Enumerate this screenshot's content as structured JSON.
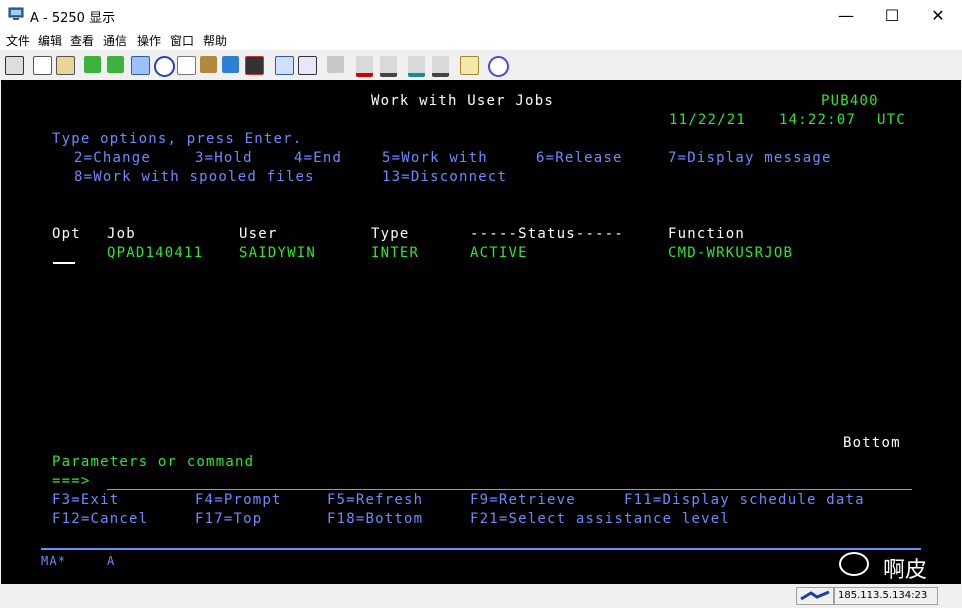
{
  "window": {
    "title": "A - 5250 显示",
    "minimize_glyph": "—",
    "maximize_glyph": "☐",
    "close_glyph": "✕"
  },
  "menu": [
    "文件",
    "编辑",
    "查看",
    "通信",
    "操作",
    "窗口",
    "帮助"
  ],
  "toolbar_icons": [
    "print-screen-icon",
    "copy-icon",
    "paste-icon",
    "send-file-icon",
    "receive-file-icon",
    "macro-icon",
    "navigator-icon",
    "notes-icon",
    "box-icon",
    "palette-icon",
    "film-icon",
    "keypad-icon",
    "grid-icon",
    "tools-icon",
    "record-macro-icon",
    "stop-macro-icon",
    "play-macro-icon",
    "pause-icon",
    "clipboard-icon",
    "help-icon"
  ],
  "screen": {
    "title": "Work with User Jobs",
    "system": "PUB400",
    "date": "11/22/21",
    "time": "14:22:07",
    "tz": "UTC",
    "instructions": "Type options, press Enter.",
    "options_line1": [
      "2=Change",
      "3=Hold",
      "4=End",
      "5=Work with",
      "6=Release",
      "7=Display message"
    ],
    "options_line2": [
      "8=Work with spooled files",
      "13=Disconnect"
    ],
    "columns": {
      "opt": "Opt",
      "job": "Job",
      "user": "User",
      "type": "Type",
      "status": "-----Status-----",
      "function": "Function"
    },
    "rows": [
      {
        "job": "QPAD140411",
        "user": "SAIDYWIN",
        "type": "INTER",
        "status": "ACTIVE",
        "function": "CMD-WRKUSRJOB"
      }
    ],
    "more": "Bottom",
    "params_label": "Parameters or command",
    "prompt": "===>",
    "fkeys_line1": [
      "F3=Exit",
      "F4=Prompt",
      "F5=Refresh",
      "F9=Retrieve",
      "F11=Display schedule data"
    ],
    "fkeys_line2": [
      "F12=Cancel",
      "F17=Top",
      "F18=Bottom",
      "F21=Select assistance level"
    ],
    "oia_ma": "MA*",
    "oia_a": "A"
  },
  "watermark": {
    "text": "啊皮"
  },
  "status_bar": {
    "address": "185.113.5.134:23"
  },
  "colors": {
    "green": "#2ee62e",
    "blue": "#6b8cff",
    "white": "#ffffff",
    "background": "#000000"
  }
}
